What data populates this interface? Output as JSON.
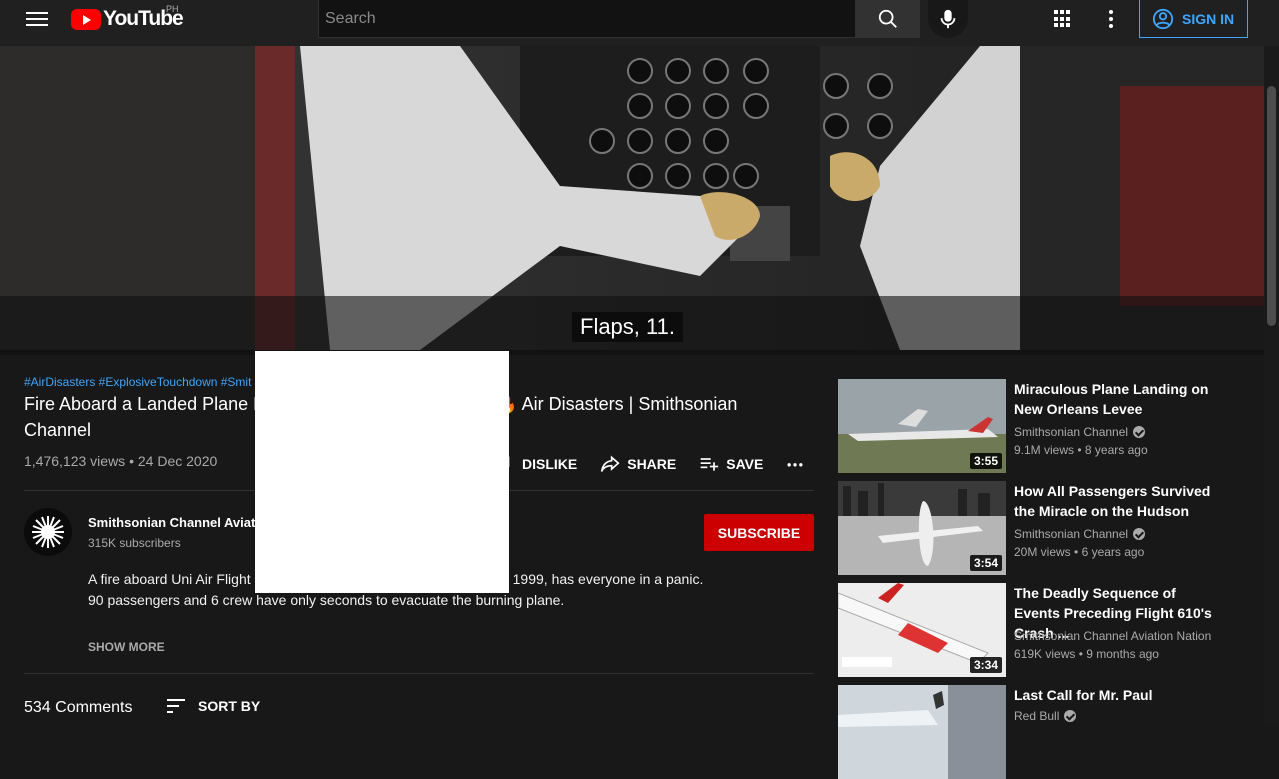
{
  "header": {
    "logo_text": "YouTube",
    "region": "PH",
    "search_placeholder": "Search",
    "sign_in_label": "SIGN IN",
    "icons": [
      "menu-icon",
      "search-icon",
      "mic-icon",
      "apps-icon",
      "more-vert-icon",
      "account-icon"
    ]
  },
  "player": {
    "caption": "Flaps, 11."
  },
  "video": {
    "hashtags": "#AirDisasters #ExplosiveTouchdown #Smit",
    "title": "Fire Aboard a Landed Plane L",
    "title_tail": "Air Disasters | Smithsonian Channel",
    "views": "1,476,123 views",
    "date": "24 Dec 2020",
    "dislike_label": "DISLIKE",
    "share_label": "SHARE",
    "save_label": "SAVE"
  },
  "channel": {
    "name": "Smithsonian Channel Aviat",
    "subscribers": "315K subscribers",
    "subscribe_label": "SUBSCRIBE"
  },
  "description": {
    "line1_start": "A fire aboard Uni Air Flight",
    "line1_end": "1999, has everyone in a panic.",
    "line2": "90 passengers and 6 crew have only seconds to evacuate the burning plane.",
    "show_more": "SHOW MORE"
  },
  "comments": {
    "count": "534 Comments",
    "sort_label": "SORT BY"
  },
  "recommendations": [
    {
      "title": "Miraculous Plane Landing on New Orleans Levee",
      "channel": "Smithsonian Channel",
      "verified": true,
      "views": "9.1M views",
      "age": "8 years ago",
      "duration": "3:55"
    },
    {
      "title": "How All Passengers Survived the Miracle on the Hudson",
      "channel": "Smithsonian Channel",
      "verified": true,
      "views": "20M views",
      "age": "6 years ago",
      "duration": "3:54"
    },
    {
      "title": "The Deadly Sequence of Events Preceding Flight 610's Crash ...",
      "channel": "Smithsonian Channel Aviation Nation",
      "verified": false,
      "views": "619K views",
      "age": "9 months ago",
      "duration": "3:34"
    },
    {
      "title": "Last Call for Mr. Paul",
      "channel": "Red Bull",
      "verified": true,
      "views": "",
      "age": "",
      "duration": ""
    }
  ],
  "colors": {
    "background": "#181818",
    "header": "#202020",
    "accent_blue": "#3ea6ff",
    "subscribe_red": "#cc0000",
    "logo_red": "#ff0000"
  }
}
